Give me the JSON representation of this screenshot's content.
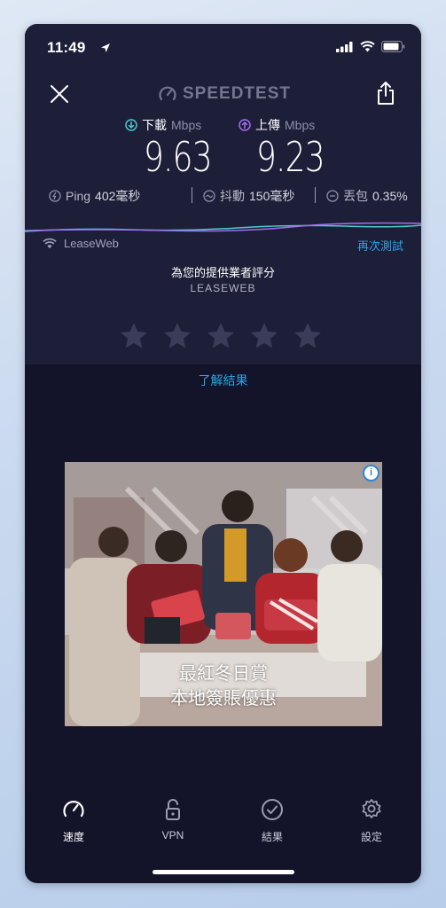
{
  "status": {
    "time": "11:49"
  },
  "header": {
    "brand": "SPEEDTEST"
  },
  "metrics": {
    "download": {
      "label": "下載",
      "unit": "Mbps",
      "value": "9.63"
    },
    "upload": {
      "label": "上傳",
      "unit": "Mbps",
      "value": "9.23"
    }
  },
  "stats": {
    "ping": {
      "label": "Ping",
      "value": "402毫秒"
    },
    "jitter": {
      "label": "抖動",
      "value": "150毫秒"
    },
    "loss": {
      "label": "丟包",
      "value": "0.35%"
    }
  },
  "server": {
    "name": "LeaseWeb",
    "retest_label": "再次測試"
  },
  "rating": {
    "title": "為您的提供業者評分",
    "provider": "LEASEWEB",
    "stars": 5,
    "filled": 0
  },
  "learn_more": "了解結果",
  "ad": {
    "line1": "最紅冬日賞",
    "line2": "本地簽賬優惠",
    "info_glyph": "i"
  },
  "tabs": [
    {
      "label": "速度",
      "icon": "speedometer-icon"
    },
    {
      "label": "VPN",
      "icon": "lock-icon"
    },
    {
      "label": "結果",
      "icon": "check-circle-icon"
    },
    {
      "label": "設定",
      "icon": "gear-icon"
    }
  ],
  "colors": {
    "panel": "#1d1e37",
    "background": "#13142a",
    "download_accent": "#4ec9d2",
    "upload_accent": "#a36ff0",
    "link": "#2aa4e8"
  }
}
